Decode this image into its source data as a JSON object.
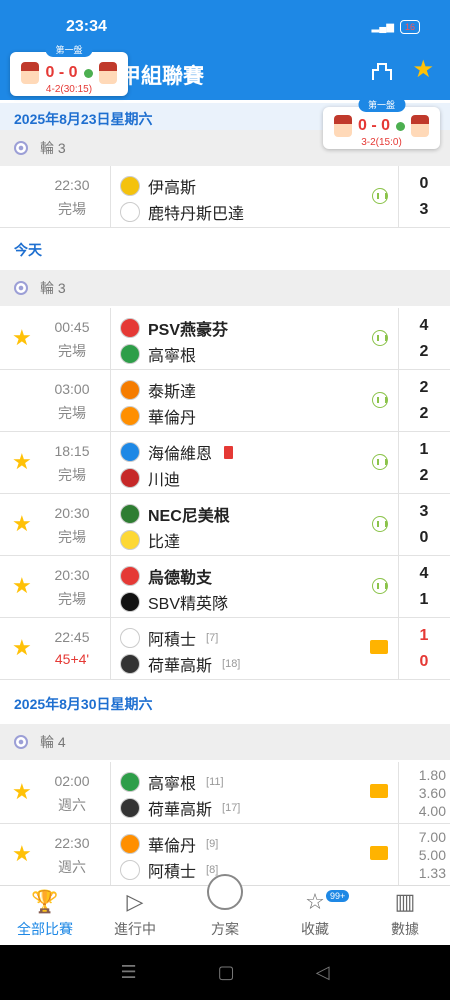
{
  "status_bar": {
    "time": "23:34",
    "battery": "16"
  },
  "header": {
    "title": "甲組聯賽"
  },
  "live_cards": [
    {
      "tag": "第一盤",
      "score": "0 - 0",
      "sub": "4-2(30:15)"
    },
    {
      "tag": "第一盤",
      "score": "0 - 0",
      "sub": "3-2(15:0)"
    }
  ],
  "sections": [
    {
      "date": "2025年8月23日星期六",
      "round": "輪 3"
    },
    {
      "date": "今天",
      "round": "輪 3"
    },
    {
      "date": "2025年8月30日星期六",
      "round": "輪 4"
    }
  ],
  "matches": [
    {
      "time": "22:30",
      "status": "完場",
      "home": "伊高斯",
      "away": "鹿特丹斯巴達",
      "hs": "0",
      "as": "3",
      "fav": false,
      "home_color": "#f4c20d",
      "away_color": "#111111"
    },
    {
      "time": "00:45",
      "status": "完場",
      "home": "PSV燕豪芬",
      "away": "高寧根",
      "hs": "4",
      "as": "2",
      "fav": true,
      "home_color": "#e53935",
      "away_color": "#2e9e49"
    },
    {
      "time": "03:00",
      "status": "完場",
      "home": "泰斯達",
      "away": "華倫丹",
      "hs": "2",
      "as": "2",
      "fav": false,
      "home_color": "#f57c00",
      "away_color": "#ff8f00"
    },
    {
      "time": "18:15",
      "status": "完場",
      "home": "海倫維恩",
      "away": "川迪",
      "hs": "1",
      "as": "2",
      "fav": true,
      "home_color": "#1e88e5",
      "away_color": "#c62828"
    },
    {
      "time": "20:30",
      "status": "完場",
      "home": "NEC尼美根",
      "away": "比達",
      "hs": "3",
      "as": "0",
      "fav": true,
      "home_color": "#2e7d32",
      "away_color": "#fdd835"
    },
    {
      "time": "20:30",
      "status": "完場",
      "home": "烏德勒支",
      "away": "SBV精英隊",
      "hs": "4",
      "as": "1",
      "fav": true,
      "home_color": "#e53935",
      "away_color": "#111111"
    },
    {
      "time": "22:45",
      "status": "45+4'",
      "home": "阿積士",
      "home_rank": "[7]",
      "away": "荷華高斯",
      "away_rank": "[18]",
      "hs": "1",
      "as": "0",
      "fav": true,
      "home_color": "#e53935",
      "away_color": "#333333"
    },
    {
      "time": "02:00",
      "status": "週六",
      "home": "高寧根",
      "home_rank": "[11]",
      "away": "荷華高斯",
      "away_rank": "[17]",
      "odds": [
        "1.80",
        "3.60",
        "4.00"
      ],
      "fav": true,
      "home_color": "#2e9e49",
      "away_color": "#333333"
    },
    {
      "time": "22:30",
      "status": "週六",
      "home": "華倫丹",
      "home_rank": "[9]",
      "away": "阿積士",
      "away_rank": "[8]",
      "odds": [
        "7.00",
        "5.00",
        "1.33"
      ],
      "fav": true,
      "home_color": "#ff8f00",
      "away_color": "#e53935"
    }
  ],
  "bottom_nav": [
    {
      "label": "全部比賽",
      "icon": "trophy-icon"
    },
    {
      "label": "進行中",
      "icon": "play-icon"
    },
    {
      "label": "方案",
      "icon": "plan-icon"
    },
    {
      "label": "收藏",
      "icon": "star-icon",
      "badge": "99+"
    },
    {
      "label": "數據",
      "icon": "stats-icon"
    }
  ]
}
